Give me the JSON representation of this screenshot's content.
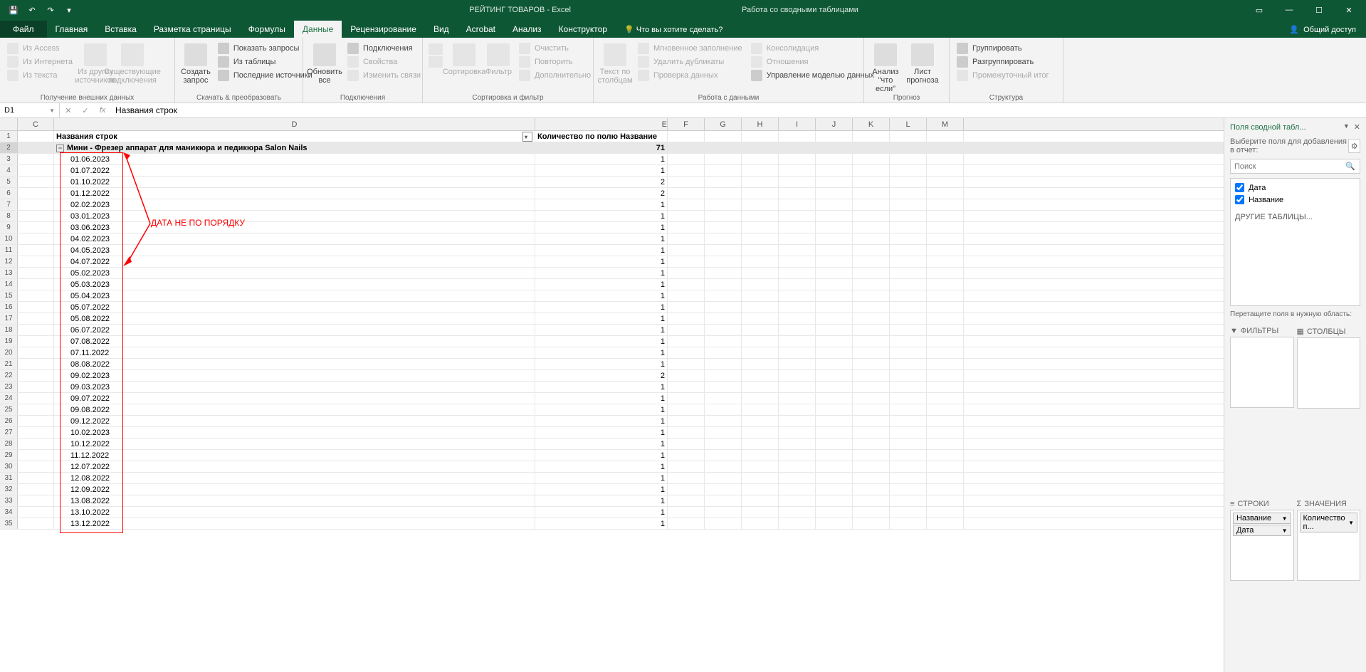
{
  "title": {
    "doc": "РЕЙТИНГ ТОВАРОВ - Excel",
    "context": "Работа со сводными таблицами"
  },
  "tabs": {
    "file": "Файл",
    "items": [
      "Главная",
      "Вставка",
      "Разметка страницы",
      "Формулы",
      "Данные",
      "Рецензирование",
      "Вид",
      "Acrobat",
      "Анализ",
      "Конструктор"
    ],
    "active": "Данные",
    "tell_me": "Что вы хотите сделать?",
    "share": "Общий доступ"
  },
  "ribbon": {
    "g1": {
      "label": "Получение внешних данных",
      "access": "Из Access",
      "web": "Из Интернета",
      "text": "Из текста",
      "other": "Из других источников",
      "existing": "Существующие подключения"
    },
    "g2": {
      "label": "Скачать & преобразовать",
      "create": "Создать запрос",
      "show": "Показать запросы",
      "table": "Из таблицы",
      "recent": "Последние источники"
    },
    "g3": {
      "label": "Подключения",
      "refresh": "Обновить все",
      "conn": "Подключения",
      "props": "Свойства",
      "links": "Изменить связи"
    },
    "g4": {
      "label": "Сортировка и фильтр",
      "sort": "Сортировка",
      "filter": "Фильтр",
      "clear": "Очистить",
      "reapply": "Повторить",
      "adv": "Дополнительно"
    },
    "g5": {
      "label": "Работа с данными",
      "t2c": "Текст по столбцам",
      "flash": "Мгновенное заполнение",
      "dup": "Удалить дубликаты",
      "valid": "Проверка данных",
      "consol": "Консолидация",
      "rel": "Отношения",
      "model": "Управление моделью данных"
    },
    "g6": {
      "label": "Прогноз",
      "whatif": "Анализ \"что если\"",
      "forecast": "Лист прогноза"
    },
    "g7": {
      "label": "Структура",
      "group": "Группировать",
      "ungroup": "Разгруппировать",
      "subtotal": "Промежуточный итог"
    }
  },
  "namebox": "D1",
  "formula": "Названия строк",
  "cols": [
    "C",
    "D",
    "E",
    "F",
    "G",
    "H",
    "I",
    "J",
    "K",
    "L",
    "M"
  ],
  "headers": {
    "d": "Названия строк",
    "e": "Количество по полю Название"
  },
  "group_row": {
    "label": "Мини - Фрезер аппарат для маникюра и педикюра Salon Nails",
    "val": "71"
  },
  "annotation": "ДАТА НЕ ПО ПОРЯДКУ",
  "data_rows": [
    {
      "d": "01.06.2023",
      "e": "1"
    },
    {
      "d": "01.07.2022",
      "e": "1"
    },
    {
      "d": "01.10.2022",
      "e": "2"
    },
    {
      "d": "01.12.2022",
      "e": "2"
    },
    {
      "d": "02.02.2023",
      "e": "1"
    },
    {
      "d": "03.01.2023",
      "e": "1"
    },
    {
      "d": "03.06.2023",
      "e": "1"
    },
    {
      "d": "04.02.2023",
      "e": "1"
    },
    {
      "d": "04.05.2023",
      "e": "1"
    },
    {
      "d": "04.07.2022",
      "e": "1"
    },
    {
      "d": "05.02.2023",
      "e": "1"
    },
    {
      "d": "05.03.2023",
      "e": "1"
    },
    {
      "d": "05.04.2023",
      "e": "1"
    },
    {
      "d": "05.07.2022",
      "e": "1"
    },
    {
      "d": "05.08.2022",
      "e": "1"
    },
    {
      "d": "06.07.2022",
      "e": "1"
    },
    {
      "d": "07.08.2022",
      "e": "1"
    },
    {
      "d": "07.11.2022",
      "e": "1"
    },
    {
      "d": "08.08.2022",
      "e": "1"
    },
    {
      "d": "09.02.2023",
      "e": "2"
    },
    {
      "d": "09.03.2023",
      "e": "1"
    },
    {
      "d": "09.07.2022",
      "e": "1"
    },
    {
      "d": "09.08.2022",
      "e": "1"
    },
    {
      "d": "09.12.2022",
      "e": "1"
    },
    {
      "d": "10.02.2023",
      "e": "1"
    },
    {
      "d": "10.12.2022",
      "e": "1"
    },
    {
      "d": "11.12.2022",
      "e": "1"
    },
    {
      "d": "12.07.2022",
      "e": "1"
    },
    {
      "d": "12.08.2022",
      "e": "1"
    },
    {
      "d": "12.09.2022",
      "e": "1"
    },
    {
      "d": "13.08.2022",
      "e": "1"
    },
    {
      "d": "13.10.2022",
      "e": "1"
    },
    {
      "d": "13.12.2022",
      "e": "1"
    }
  ],
  "pane": {
    "title": "Поля сводной табл...",
    "sub": "Выберите поля для добавления в отчет:",
    "search": "Поиск",
    "fields": [
      {
        "name": "Дата",
        "checked": true
      },
      {
        "name": "Название",
        "checked": true
      }
    ],
    "other": "ДРУГИЕ ТАБЛИЦЫ...",
    "drag": "Перетащите поля в нужную область:",
    "areas": {
      "filters": "ФИЛЬТРЫ",
      "cols": "СТОЛБЦЫ",
      "rows": "СТРОКИ",
      "vals": "ЗНАЧЕНИЯ"
    },
    "row_tags": [
      "Название",
      "Дата"
    ],
    "val_tags": [
      "Количество п..."
    ]
  }
}
